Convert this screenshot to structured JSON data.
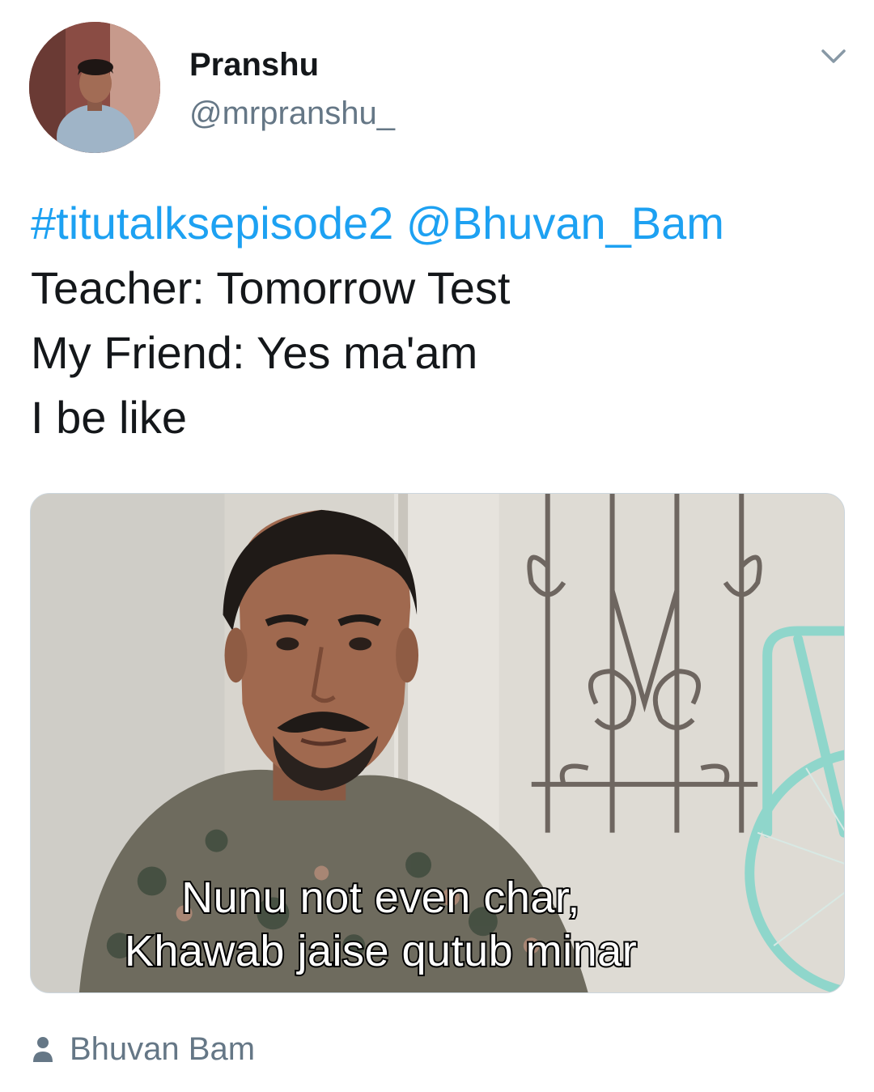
{
  "author": {
    "display_name": "Pranshu",
    "handle": "@mrpranshu_"
  },
  "tweet": {
    "hashtag": "#titutalksepisode2",
    "mention": "@Bhuvan_Bam",
    "lines": [
      "Teacher: Tomorrow Test",
      "My Friend: Yes ma'am",
      "I be like"
    ]
  },
  "media": {
    "caption_lines": [
      "Nunu not even char,",
      "Khawab jaise qutub minar"
    ]
  },
  "media_credit": {
    "name": "Bhuvan Bam"
  },
  "icons": {
    "caret": "chevron-down-icon",
    "user": "user-icon"
  },
  "colors": {
    "link": "#1da1f2",
    "secondary_text": "#657786",
    "primary_text": "#14171a"
  }
}
